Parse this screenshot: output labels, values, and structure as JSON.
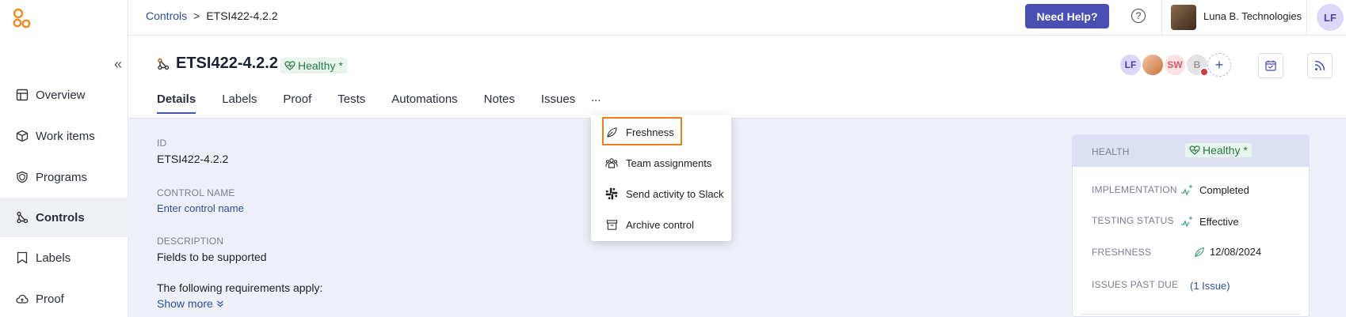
{
  "sidebar": {
    "items": [
      {
        "label": "Overview",
        "icon": "overview-icon"
      },
      {
        "label": "Work items",
        "icon": "box-icon"
      },
      {
        "label": "Programs",
        "icon": "shield-icon"
      },
      {
        "label": "Controls",
        "icon": "controls-icon"
      },
      {
        "label": "Labels",
        "icon": "label-icon"
      },
      {
        "label": "Proof",
        "icon": "cloud-icon"
      }
    ],
    "active": "Controls",
    "collapse_glyph": "«"
  },
  "topbar": {
    "breadcrumb_root": "Controls",
    "breadcrumb_sep": ">",
    "breadcrumb_current": "ETSI422-4.2.2",
    "help_label": "Need Help?",
    "help_glyph": "?",
    "org_name": "Luna B. Technologies",
    "user_initials": "LF"
  },
  "header": {
    "title": "ETSI422-4.2.2",
    "health": "Healthy *",
    "tabs": [
      "Details",
      "Labels",
      "Proof",
      "Tests",
      "Automations",
      "Notes",
      "Issues"
    ],
    "more_label": "...",
    "team": [
      "LF",
      "",
      "SW",
      "B"
    ],
    "add_glyph": "+"
  },
  "details": {
    "id_label": "ID",
    "id_value": "ETSI422-4.2.2",
    "name_label": "CONTROL NAME",
    "name_placeholder": "Enter control name",
    "desc_label": "DESCRIPTION",
    "desc_line1": "Fields to be supported",
    "desc_line2": "The following requirements apply:",
    "show_more": "Show more"
  },
  "dropdown": {
    "items": [
      "Freshness",
      "Team assignments",
      "Send activity to Slack",
      "Archive control"
    ]
  },
  "panel": {
    "health_label": "HEALTH",
    "health_value": "Healthy *",
    "impl_label": "IMPLEMENTATION",
    "impl_value": "Completed",
    "testing_label": "TESTING STATUS",
    "testing_value": "Effective",
    "fresh_label": "FRESHNESS",
    "fresh_value": "12/08/2024",
    "issues_label": "ISSUES PAST DUE",
    "issues_value": "(1 Issue)"
  },
  "colors": {
    "accent": "#4a4fb3",
    "link": "#2b4ea2",
    "healthy": "#237a46",
    "highlight": "#f07c1a",
    "logo": "#f08a24"
  }
}
